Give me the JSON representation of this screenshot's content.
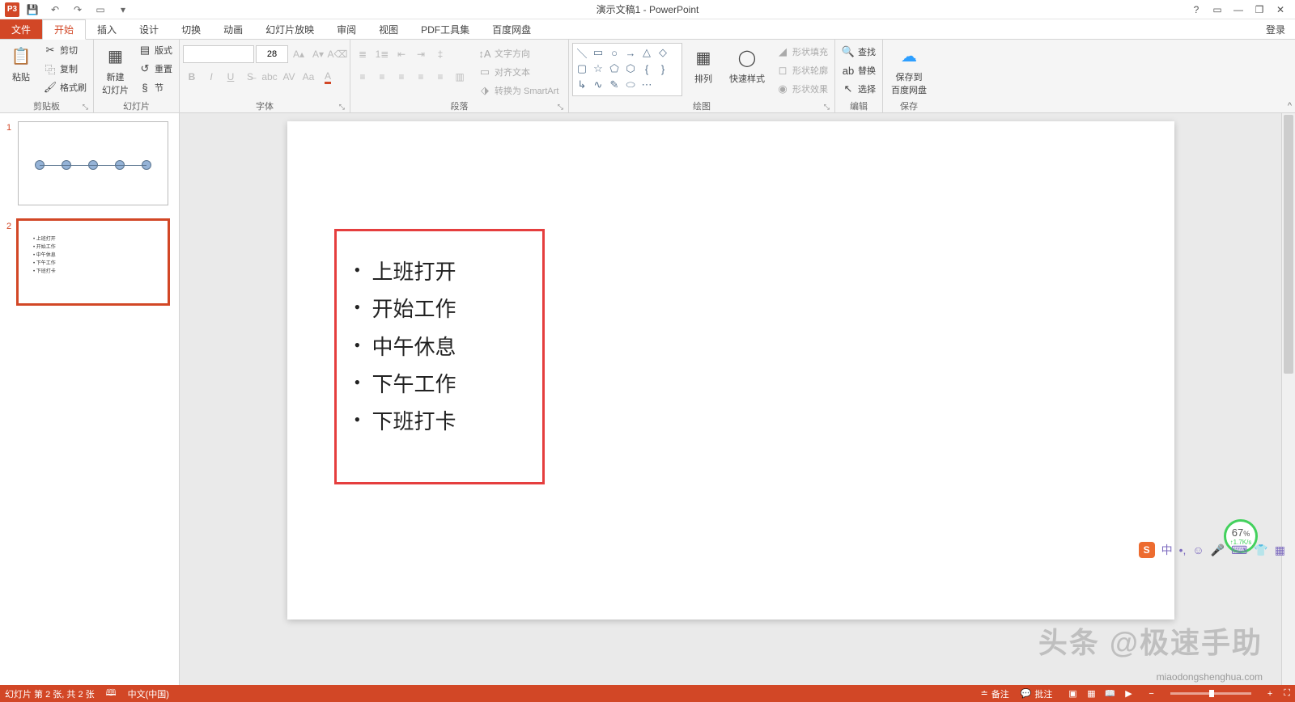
{
  "title": "演示文稿1 - PowerPoint",
  "qat": {
    "app": "P3"
  },
  "win": {
    "help": "?",
    "ribbon": "▭",
    "min": "—",
    "max": "❐",
    "close": "✕"
  },
  "menu": {
    "file": "文件",
    "tabs": [
      "开始",
      "插入",
      "设计",
      "切换",
      "动画",
      "幻灯片放映",
      "审阅",
      "视图",
      "PDF工具集",
      "百度网盘"
    ],
    "login": "登录"
  },
  "ribbon": {
    "clipboard": {
      "label": "剪贴板",
      "paste": "粘贴",
      "cut": "剪切",
      "copy": "复制",
      "format": "格式刷"
    },
    "slides": {
      "label": "幻灯片",
      "new": "新建\n幻灯片",
      "layout": "版式",
      "reset": "重置",
      "section": "节"
    },
    "font": {
      "label": "字体",
      "size": "28"
    },
    "paragraph": {
      "label": "段落",
      "textdir": "文字方向",
      "align": "对齐文本",
      "smartart": "转换为 SmartArt"
    },
    "drawing": {
      "label": "绘图",
      "arrange": "排列",
      "quick": "快速样式",
      "fill": "形状填充",
      "outline": "形状轮廓",
      "effects": "形状效果"
    },
    "editing": {
      "label": "编辑",
      "find": "查找",
      "replace": "替换",
      "select": "选择"
    },
    "save": {
      "label": "保存",
      "btn": "保存到\n百度网盘"
    }
  },
  "thumbs": {
    "s1": "1",
    "s2": "2",
    "s2_lines": [
      "上班打开",
      "开始工作",
      "中午休息",
      "下午工作",
      "下班打卡"
    ]
  },
  "slide": {
    "bullets": [
      "上班打开",
      "开始工作",
      "中午休息",
      "下午工作",
      "下班打卡"
    ]
  },
  "status": {
    "slide": "幻灯片 第 2 张, 共 2 张",
    "lang": "中文(中国)",
    "notes": "备注",
    "comments": "批注",
    "zoom_minus": "−",
    "zoom_plus": "+",
    "fit": "⛶"
  },
  "overlay": {
    "pct": "67",
    "pct_sym": "%",
    "speed": "↑1.7K/s",
    "ime_zh": "中"
  },
  "watermark": {
    "w1": "头条 @极速手助",
    "w2": "miaodongshenghua.com"
  }
}
